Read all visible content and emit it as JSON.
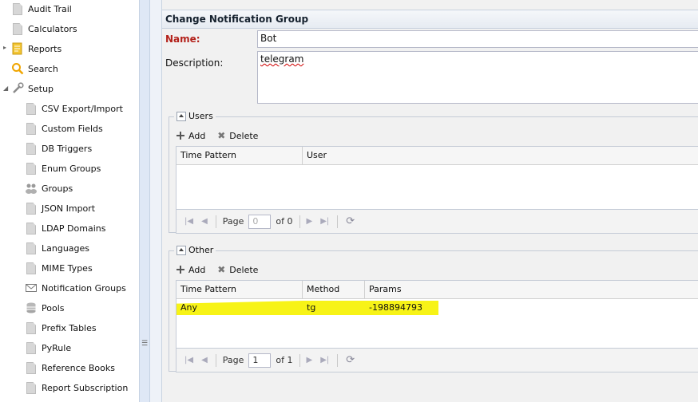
{
  "sidebar": {
    "items": [
      {
        "label": "Audit Trail",
        "icon": "document-icon"
      },
      {
        "label": "Calculators",
        "icon": "document-icon"
      },
      {
        "label": "Reports",
        "icon": "reports-folder-icon"
      },
      {
        "label": "Search",
        "icon": "search-icon"
      },
      {
        "label": "Setup",
        "icon": "wrench-icon"
      },
      {
        "label": "CSV Export/Import",
        "icon": "document-icon"
      },
      {
        "label": "Custom Fields",
        "icon": "document-icon"
      },
      {
        "label": "DB Triggers",
        "icon": "document-icon"
      },
      {
        "label": "Enum Groups",
        "icon": "document-icon"
      },
      {
        "label": "Groups",
        "icon": "users-group-icon"
      },
      {
        "label": "JSON Import",
        "icon": "document-icon"
      },
      {
        "label": "LDAP Domains",
        "icon": "document-icon"
      },
      {
        "label": "Languages",
        "icon": "document-icon"
      },
      {
        "label": "MIME Types",
        "icon": "document-icon"
      },
      {
        "label": "Notification Groups",
        "icon": "envelope-icon"
      },
      {
        "label": "Pools",
        "icon": "database-icon"
      },
      {
        "label": "Prefix Tables",
        "icon": "document-icon"
      },
      {
        "label": "PyRule",
        "icon": "document-icon"
      },
      {
        "label": "Reference Books",
        "icon": "document-icon"
      },
      {
        "label": "Report Subscription",
        "icon": "document-icon"
      }
    ]
  },
  "form": {
    "title": "Change Notification Group",
    "name_label": "Name:",
    "name_value": "Bot",
    "description_label": "Description:",
    "description_value": "telegram"
  },
  "users": {
    "legend": "Users",
    "add_label": "Add",
    "delete_label": "Delete",
    "columns": [
      "Time Pattern",
      "User"
    ],
    "pager": {
      "page_label": "Page",
      "page_value": "0",
      "of_label": "of 0"
    }
  },
  "other": {
    "legend": "Other",
    "add_label": "Add",
    "delete_label": "Delete",
    "columns": [
      "Time Pattern",
      "Method",
      "Params"
    ],
    "rows": [
      {
        "time_pattern": "Any",
        "method": "tg",
        "params": "-198894793"
      }
    ],
    "pager": {
      "page_label": "Page",
      "page_value": "1",
      "of_label": "of 1"
    }
  },
  "colors": {
    "highlight": "#f7f317",
    "required_label": "#b3211a"
  }
}
